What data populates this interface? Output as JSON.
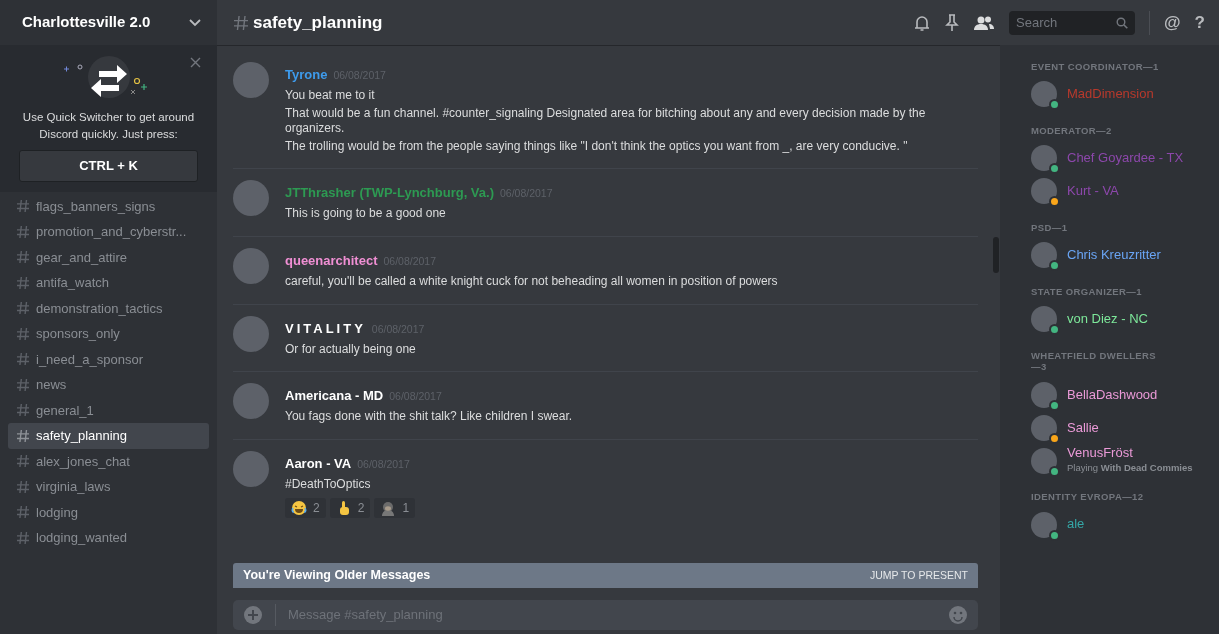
{
  "server": {
    "name": "Charlottesville 2.0"
  },
  "switcher_tip": {
    "text": "Use Quick Switcher to get around Discord quickly. Just press:",
    "shortcut": "CTRL + K"
  },
  "channels": [
    {
      "name": "flags_banners_signs",
      "selected": false
    },
    {
      "name": "promotion_and_cyberstr...",
      "selected": false
    },
    {
      "name": "gear_and_attire",
      "selected": false
    },
    {
      "name": "antifa_watch",
      "selected": false
    },
    {
      "name": "demonstration_tactics",
      "selected": false
    },
    {
      "name": "sponsors_only",
      "selected": false
    },
    {
      "name": "i_need_a_sponsor",
      "selected": false
    },
    {
      "name": "news",
      "selected": false
    },
    {
      "name": "general_1",
      "selected": false
    },
    {
      "name": "safety_planning",
      "selected": true
    },
    {
      "name": "alex_jones_chat",
      "selected": false
    },
    {
      "name": "virginia_laws",
      "selected": false
    },
    {
      "name": "lodging",
      "selected": false
    },
    {
      "name": "lodging_wanted",
      "selected": false
    }
  ],
  "header": {
    "channel": "safety_planning",
    "search_placeholder": "Search",
    "mention_glyph": "@",
    "help_glyph": "?"
  },
  "messages": [
    {
      "author": "Tyrone",
      "color": "#3e9bec",
      "spaced": false,
      "time": "06/08/2017",
      "lines": [
        "You beat me to it",
        "That would be a fun channel. #counter_signaling   Designated area for bitching about any and every decision made by the organizers.",
        "The trolling would be from the people saying things like \"I don't think the optics you want from _, are very conducive. \""
      ]
    },
    {
      "author": "JTThrasher (TWP-Lynchburg, Va.)",
      "color": "#2d9a52",
      "spaced": false,
      "time": "06/08/2017",
      "lines": [
        "This is going to be a good one"
      ]
    },
    {
      "author": "queenarchitect",
      "color": "#f08fd4",
      "spaced": false,
      "time": "06/08/2017",
      "lines": [
        "careful, you'll be called a white knight cuck for not beheading all women in position of powers"
      ]
    },
    {
      "author": "VITALITY",
      "color": "#ffffff",
      "spaced": true,
      "time": "06/08/2017",
      "lines": [
        "Or for actually being one"
      ]
    },
    {
      "author": "Americana - MD",
      "color": "#ffffff",
      "spaced": false,
      "time": "06/08/2017",
      "lines": [
        "You fags done with the shit talk? Like children I swear."
      ]
    },
    {
      "author": "Aaron - VA",
      "color": "#ffffff",
      "spaced": false,
      "time": "06/08/2017",
      "lines": [
        "#DeathToOptics"
      ],
      "reactions": [
        {
          "kind": "laugh",
          "count": "2"
        },
        {
          "kind": "point",
          "count": "2"
        },
        {
          "kind": "ape",
          "count": "1"
        }
      ]
    }
  ],
  "older_bar": {
    "text": "You're Viewing Older Messages",
    "action": "JUMP TO PRESENT"
  },
  "composer": {
    "placeholder": "Message #safety_planning"
  },
  "member_groups": [
    {
      "title": "EVENT COORDINATOR—1",
      "members": [
        {
          "name": "MadDimension",
          "color": "#b8392c",
          "status": {
            "color": "#43b581"
          }
        }
      ]
    },
    {
      "title": "MODERATOR—2",
      "members": [
        {
          "name": "Chef Goyardee - TX",
          "color": "#8c47ab",
          "status": {
            "color": "#43b581"
          }
        },
        {
          "name": "Kurt - VA",
          "color": "#8c47ab",
          "status": {
            "color": "#faa61a"
          }
        }
      ]
    },
    {
      "title": "PSD—1",
      "members": [
        {
          "name": "Chris Kreuzritter",
          "color": "#6aa5f5",
          "status": {
            "color": "#43b581"
          }
        }
      ]
    },
    {
      "title": "STATE ORGANIZER—1",
      "members": [
        {
          "name": "von Diez - NC",
          "color": "#7de89a",
          "status": {
            "color": "#43b581"
          }
        }
      ]
    },
    {
      "title": "WHEATFIELD DWELLERS—3",
      "members": [
        {
          "name": "BellaDashwood",
          "color": "#eb9ad8",
          "status": {
            "color": "#43b581"
          }
        },
        {
          "name": "Sallie",
          "color": "#eb9ad8",
          "status": {
            "color": "#faa61a"
          }
        },
        {
          "name": "VenusFröst",
          "color": "#eb9ad8",
          "status": {
            "color": "#43b581"
          },
          "activity": "Playing **With Dead Commies**"
        }
      ]
    },
    {
      "title": "IDENTITY EVROPA—12",
      "members": [
        {
          "name": "ale",
          "color": "#35a7a7",
          "status": {
            "color": "#43b581"
          }
        }
      ]
    }
  ]
}
